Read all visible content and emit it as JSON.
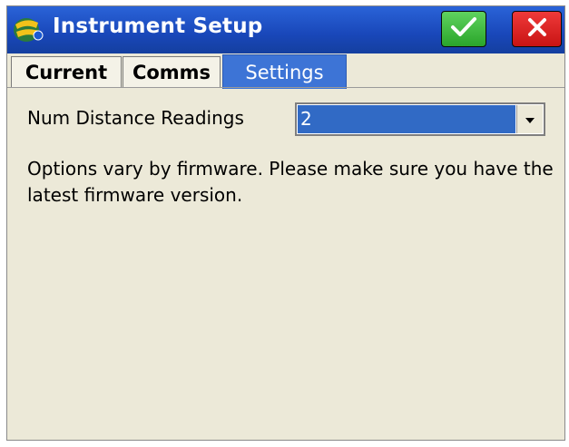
{
  "window": {
    "title": "Instrument Setup",
    "icons": {
      "app": "instrument-app-icon",
      "ok": "checkmark-icon",
      "close": "close-x-icon"
    },
    "colors": {
      "titlebar": "#1f4fc6",
      "ok_button": "#3bbb3b",
      "close_button": "#dd2222",
      "selected_tab": "#3d74d6",
      "dialog_bg": "#ece9d8"
    }
  },
  "tabs": [
    {
      "label": "Current",
      "selected": false
    },
    {
      "label": "Comms",
      "selected": false
    },
    {
      "label": "Settings",
      "selected": true
    }
  ],
  "settings": {
    "num_distance_readings_label": "Num Distance Readings",
    "num_distance_readings_value": "2",
    "firmware_note": "Options vary by firmware.  Please make sure you have the latest firmware version."
  }
}
